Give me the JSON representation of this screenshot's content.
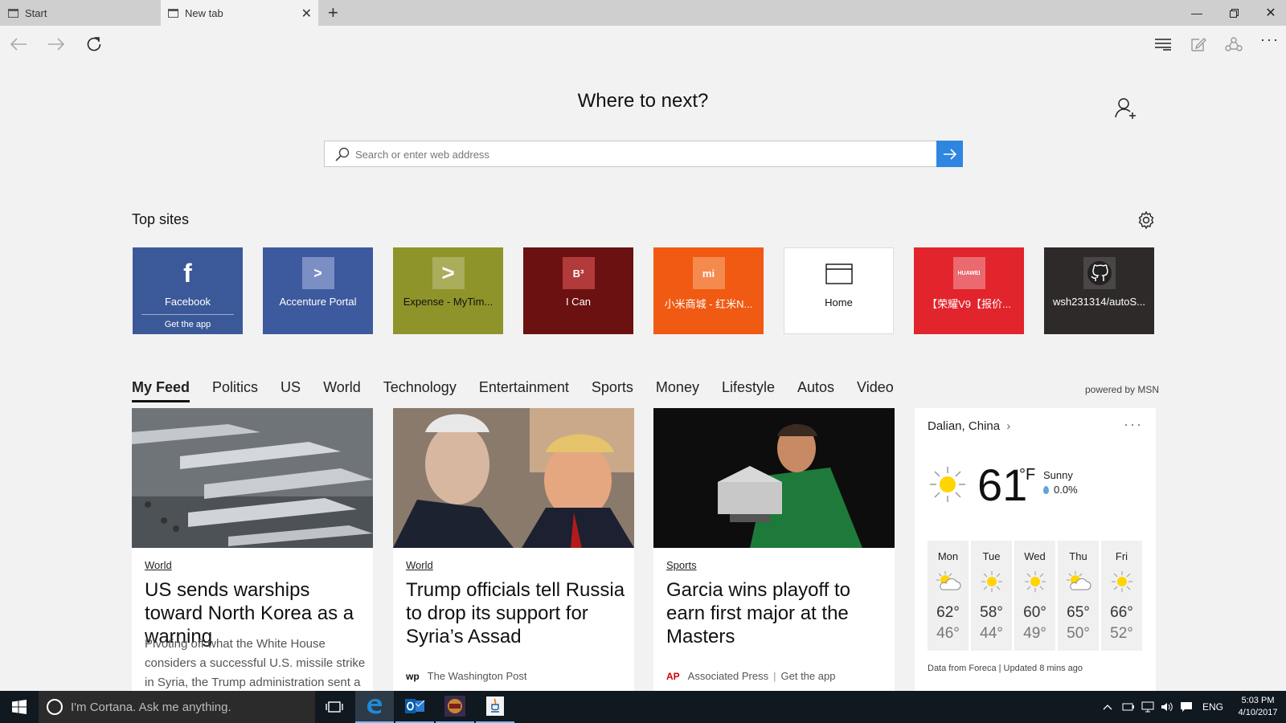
{
  "tabs": [
    {
      "label": "Start"
    },
    {
      "label": "New tab"
    }
  ],
  "search": {
    "heading": "Where to next?",
    "placeholder": "Search or enter web address"
  },
  "top_sites": {
    "title": "Top sites",
    "tiles": [
      {
        "label": "Facebook",
        "sub": "Get the app",
        "bg": "#3b5998",
        "glyph": "f"
      },
      {
        "label": "Accenture Portal",
        "bg": "#3d5a9e",
        "glyph": ">"
      },
      {
        "label": "Expense - MyTim...",
        "bg": "#8e9429",
        "glyph": ">"
      },
      {
        "label": "I Can",
        "bg": "#6b1111",
        "glyph": "B³"
      },
      {
        "label": "小米商城 - 红米N...",
        "bg": "#f05a12",
        "glyph": "mi"
      },
      {
        "label": "Home",
        "bg": "#ffffff"
      },
      {
        "label": "【荣耀V9【报价...",
        "bg": "#e2242c",
        "glyph": "HUAWEI"
      },
      {
        "label": "wsh231314/autoS...",
        "bg": "#2e2a2a"
      }
    ]
  },
  "feed": {
    "tabs": [
      "My Feed",
      "Politics",
      "US",
      "World",
      "Technology",
      "Entertainment",
      "Sports",
      "Money",
      "Lifestyle",
      "Autos",
      "Video"
    ],
    "powered": "powered by MSN",
    "cards": [
      {
        "category": "World",
        "headline": "US sends warships toward North Korea as a warning",
        "snippet": "Pivoting off what the White House considers a successful U.S. missile strike in Syria, the Trump administration sent a"
      },
      {
        "category": "World",
        "headline": "Trump officials tell Russia to drop its support for Syria’s Assad",
        "source_logo": "wp",
        "source": "The Washington Post"
      },
      {
        "category": "Sports",
        "headline": "Garcia wins playoff to earn first major at the Masters",
        "source_logo": "AP",
        "source": "Associated Press",
        "source_extra": "Get the app"
      }
    ]
  },
  "weather": {
    "location": "Dalian, China",
    "temp": "61",
    "unit": "°F",
    "condition": "Sunny",
    "precip": "0.0%",
    "forecast": [
      {
        "day": "Mon",
        "hi": "62°",
        "lo": "46°",
        "icon": "partly-cloudy"
      },
      {
        "day": "Tue",
        "hi": "58°",
        "lo": "44°",
        "icon": "sunny"
      },
      {
        "day": "Wed",
        "hi": "60°",
        "lo": "49°",
        "icon": "sunny"
      },
      {
        "day": "Thu",
        "hi": "65°",
        "lo": "50°",
        "icon": "partly-cloudy"
      },
      {
        "day": "Fri",
        "hi": "66°",
        "lo": "52°",
        "icon": "sunny"
      }
    ],
    "footer": "Data from Foreca | Updated 8 mins ago"
  },
  "taskbar": {
    "cortana": "I'm Cortana. Ask me anything.",
    "lang": "ENG",
    "time": "5:03 PM",
    "date": "4/10/2017"
  }
}
